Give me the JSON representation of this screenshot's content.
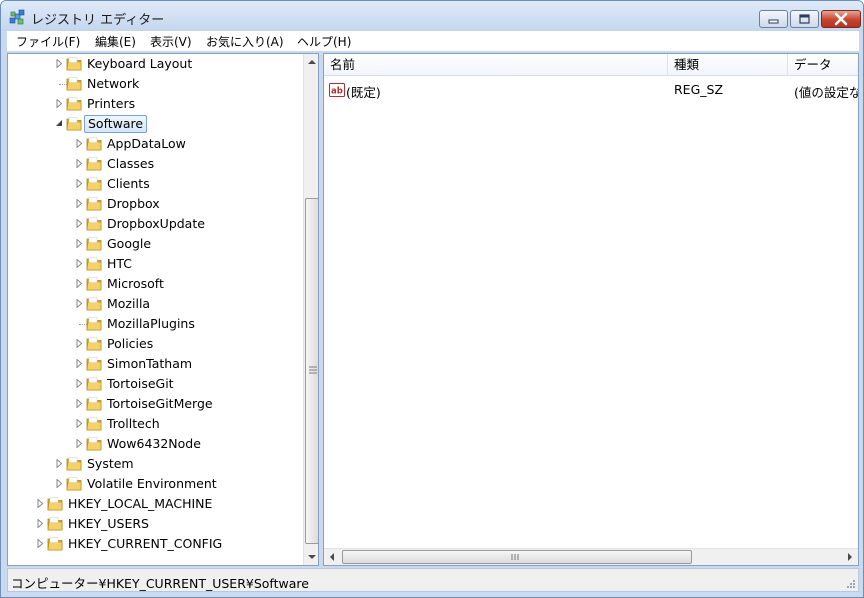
{
  "window": {
    "title": "レジストリ エディター"
  },
  "menu": [
    {
      "label": "ファイル(F)"
    },
    {
      "label": "編集(E)"
    },
    {
      "label": "表示(V)"
    },
    {
      "label": "お気に入り(A)"
    },
    {
      "label": "ヘルプ(H)"
    }
  ],
  "tree": [
    {
      "label": "Keyboard Layout",
      "level": 1,
      "expander": "collapsed"
    },
    {
      "label": "Network",
      "level": 1,
      "expander": "none"
    },
    {
      "label": "Printers",
      "level": 1,
      "expander": "collapsed"
    },
    {
      "label": "Software",
      "level": 1,
      "expander": "expanded",
      "selected": true
    },
    {
      "label": "AppDataLow",
      "level": 2,
      "expander": "collapsed"
    },
    {
      "label": "Classes",
      "level": 2,
      "expander": "collapsed"
    },
    {
      "label": "Clients",
      "level": 2,
      "expander": "collapsed"
    },
    {
      "label": "Dropbox",
      "level": 2,
      "expander": "collapsed"
    },
    {
      "label": "DropboxUpdate",
      "level": 2,
      "expander": "collapsed"
    },
    {
      "label": "Google",
      "level": 2,
      "expander": "collapsed"
    },
    {
      "label": "HTC",
      "level": 2,
      "expander": "collapsed"
    },
    {
      "label": "Microsoft",
      "level": 2,
      "expander": "collapsed"
    },
    {
      "label": "Mozilla",
      "level": 2,
      "expander": "collapsed"
    },
    {
      "label": "MozillaPlugins",
      "level": 2,
      "expander": "none"
    },
    {
      "label": "Policies",
      "level": 2,
      "expander": "collapsed"
    },
    {
      "label": "SimonTatham",
      "level": 2,
      "expander": "collapsed"
    },
    {
      "label": "TortoiseGit",
      "level": 2,
      "expander": "collapsed"
    },
    {
      "label": "TortoiseGitMerge",
      "level": 2,
      "expander": "collapsed"
    },
    {
      "label": "Trolltech",
      "level": 2,
      "expander": "collapsed"
    },
    {
      "label": "Wow6432Node",
      "level": 2,
      "expander": "collapsed"
    },
    {
      "label": "System",
      "level": 1,
      "expander": "collapsed"
    },
    {
      "label": "Volatile Environment",
      "level": 1,
      "expander": "collapsed"
    },
    {
      "label": "HKEY_LOCAL_MACHINE",
      "level": 0,
      "expander": "collapsed"
    },
    {
      "label": "HKEY_USERS",
      "level": 0,
      "expander": "collapsed"
    },
    {
      "label": "HKEY_CURRENT_CONFIG",
      "level": 0,
      "expander": "collapsed"
    }
  ],
  "list": {
    "columns": [
      "名前",
      "種類",
      "データ"
    ],
    "rows": [
      {
        "name": "(既定)",
        "type": "REG_SZ",
        "data": "(値の設定なし)"
      }
    ]
  },
  "status": {
    "path": "コンピューター¥HKEY_CURRENT_USER¥Software"
  },
  "icons": {
    "app": "registry-editor-icon",
    "tree_node": "folder-icon",
    "value": "string-value-icon"
  },
  "colors": {
    "window_frame": "#c9daf0",
    "selection": "#d6e7fa",
    "folder": "#e8c04a"
  }
}
